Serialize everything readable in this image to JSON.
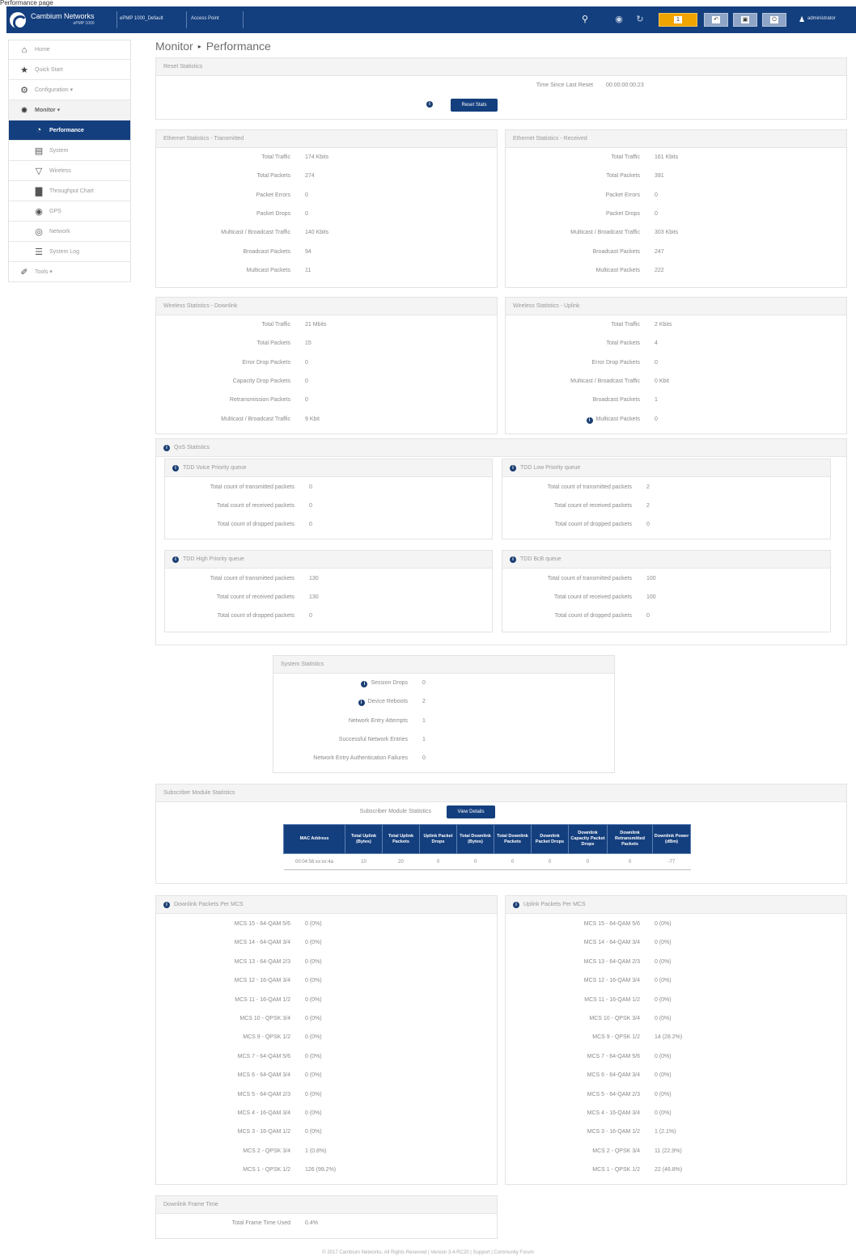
{
  "caption": "Performance page",
  "topbar": {
    "brand": "Cambium Networks",
    "brand_sub": "ePMP 1000",
    "device_name": "ePMP 1000_Default",
    "mode": "Access Point",
    "alert_count": "1",
    "user": "administrator"
  },
  "sidebar": {
    "items": [
      {
        "label": "Home",
        "icon": "home-icon",
        "level": "top",
        "state": ""
      },
      {
        "label": "Quick Start",
        "icon": "run-icon",
        "level": "top",
        "state": ""
      },
      {
        "label": "Configuration ▾",
        "icon": "gear-icon",
        "level": "top",
        "state": ""
      },
      {
        "label": "Monitor ▾",
        "icon": "monitor-icon",
        "level": "top",
        "state": "gray"
      },
      {
        "label": "Performance",
        "icon": "gauge-icon",
        "level": "sub",
        "state": "active"
      },
      {
        "label": "System",
        "icon": "system-icon",
        "level": "sub",
        "state": ""
      },
      {
        "label": "Wireless",
        "icon": "wifi-icon",
        "level": "sub",
        "state": ""
      },
      {
        "label": "Throughput Chart",
        "icon": "chart-icon",
        "level": "sub",
        "state": ""
      },
      {
        "label": "GPS",
        "icon": "globe-icon",
        "level": "sub",
        "state": ""
      },
      {
        "label": "Network",
        "icon": "network-icon",
        "level": "sub",
        "state": ""
      },
      {
        "label": "System Log",
        "icon": "log-icon",
        "level": "sub",
        "state": ""
      },
      {
        "label": "Tools ▾",
        "icon": "wrench-icon",
        "level": "top",
        "state": ""
      }
    ]
  },
  "breadcrumb": {
    "parent": "Monitor",
    "current": "Performance"
  },
  "reset": {
    "title": "Reset Statistics",
    "time_label": "Time Since Last Reset",
    "time_value": "00:00:00:00:23",
    "button": "Reset Stats"
  },
  "eth_tx": {
    "title": "Ethernet Statistics - Transmitted",
    "rows": [
      {
        "label": "Total Traffic",
        "value": "174 Kbits"
      },
      {
        "label": "Total Packets",
        "value": "274"
      },
      {
        "label": "Packet Errors",
        "value": "0"
      },
      {
        "label": "Packet Drops",
        "value": "0"
      },
      {
        "label": "Multicast / Broadcast Traffic",
        "value": "140 Kbits"
      },
      {
        "label": "Broadcast Packets",
        "value": "94"
      },
      {
        "label": "Multicast Packets",
        "value": "11"
      }
    ]
  },
  "eth_rx": {
    "title": "Ethernet Statistics - Received",
    "rows": [
      {
        "label": "Total Traffic",
        "value": "161 Kbits"
      },
      {
        "label": "Total Packets",
        "value": "391"
      },
      {
        "label": "Packet Errors",
        "value": "0"
      },
      {
        "label": "Packet Drops",
        "value": "0"
      },
      {
        "label": "Multicast / Broadcast Traffic",
        "value": "303 Kbits"
      },
      {
        "label": "Broadcast Packets",
        "value": "247"
      },
      {
        "label": "Multicast Packets",
        "value": "222"
      }
    ]
  },
  "wl_down": {
    "title": "Wireless Statistics - Downlink",
    "rows": [
      {
        "label": "Total Traffic",
        "value": "21 Mbits"
      },
      {
        "label": "Total Packets",
        "value": "15"
      },
      {
        "label": "Error Drop Packets",
        "value": "0"
      },
      {
        "label": "Capacity Drop Packets",
        "value": "0"
      },
      {
        "label": "Retransmission Packets",
        "value": "0"
      },
      {
        "label": "Multicast / Broadcast Traffic",
        "value": "9 Kbit"
      }
    ]
  },
  "wl_up": {
    "title": "Wireless Statistics - Uplink",
    "rows": [
      {
        "label": "Total Traffic",
        "value": "2 Kbits"
      },
      {
        "label": "Total Packets",
        "value": "4"
      },
      {
        "label": "Error Drop Packets",
        "value": "0"
      },
      {
        "label": "Multicast / Broadcast Traffic",
        "value": "0 Kbit"
      },
      {
        "label": "Broadcast Packets",
        "value": "1"
      },
      {
        "label": "Multicast Packets",
        "value": "0"
      }
    ]
  },
  "qos": {
    "title": "QoS Statistics",
    "queues": [
      {
        "title": "TDD Voice Priority queue",
        "rows": [
          {
            "label": "Total count of transmitted packets",
            "value": "0"
          },
          {
            "label": "Total count of received packets",
            "value": "0"
          },
          {
            "label": "Total count of dropped packets",
            "value": "0"
          }
        ]
      },
      {
        "title": "TDD Low Priority queue",
        "rows": [
          {
            "label": "Total count of transmitted packets",
            "value": "2"
          },
          {
            "label": "Total count of received packets",
            "value": "2"
          },
          {
            "label": "Total count of dropped packets",
            "value": "0"
          }
        ]
      },
      {
        "title": "TDD High Priority queue",
        "rows": [
          {
            "label": "Total count of transmitted packets",
            "value": "130"
          },
          {
            "label": "Total count of received packets",
            "value": "130"
          },
          {
            "label": "Total count of dropped packets",
            "value": "0"
          }
        ]
      },
      {
        "title": "TDD BcB queue",
        "rows": [
          {
            "label": "Total count of transmitted packets",
            "value": "100"
          },
          {
            "label": "Total count of received packets",
            "value": "100"
          },
          {
            "label": "Total count of dropped packets",
            "value": "0"
          }
        ]
      }
    ]
  },
  "system": {
    "title": "System Statistics",
    "rows": [
      {
        "label": "Session Drops",
        "value": "0",
        "info": true
      },
      {
        "label": "Device Reboots",
        "value": "2",
        "info": true
      },
      {
        "label": "Network Entry Attempts",
        "value": "1",
        "info": false
      },
      {
        "label": "Successful Network Entries",
        "value": "1",
        "info": false
      },
      {
        "label": "Network Entry Authentication Failures",
        "value": "0",
        "info": false
      }
    ]
  },
  "sm_stats": {
    "title": "Subscriber Module Statistics",
    "details_label": "Subscriber Module Statistics",
    "details_button": "View Details",
    "columns": [
      "MAC Address",
      "Total Uplink (Bytes)",
      "Total Uplink Packets",
      "Uplink Packet Drops",
      "Total Downlink (Bytes)",
      "Total Downlink Packets",
      "Downlink Packet Drops",
      "Downlink Capacity Packet Drops",
      "Downlink Retransmitted Packets",
      "Downlink Power (dBm)"
    ],
    "rows": [
      [
        "00:04:56:xx:xx:4a",
        "10",
        "20",
        "0",
        "0",
        "0",
        "0",
        "0",
        "0",
        "-77"
      ]
    ]
  },
  "down_mcs": {
    "title": "Downlink Packets Per MCS",
    "rows": [
      {
        "label": "MCS 15 - 64-QAM 5/6",
        "value": "0 (0%)"
      },
      {
        "label": "MCS 14 - 64-QAM 3/4",
        "value": "0 (0%)"
      },
      {
        "label": "MCS 13 - 64-QAM 2/3",
        "value": "0 (0%)"
      },
      {
        "label": "MCS 12 - 16-QAM 3/4",
        "value": "0 (0%)"
      },
      {
        "label": "MCS 11 - 16-QAM 1/2",
        "value": "0 (0%)"
      },
      {
        "label": "MCS 10 - QPSK 3/4",
        "value": "0 (0%)"
      },
      {
        "label": "MCS 9 - QPSK 1/2",
        "value": "0 (0%)"
      },
      {
        "label": "MCS 7 - 64-QAM 5/6",
        "value": "0 (0%)"
      },
      {
        "label": "MCS 6 - 64-QAM 3/4",
        "value": "0 (0%)"
      },
      {
        "label": "MCS 5 - 64-QAM 2/3",
        "value": "0 (0%)"
      },
      {
        "label": "MCS 4 - 16-QAM 3/4",
        "value": "0 (0%)"
      },
      {
        "label": "MCS 3 - 16-QAM 1/2",
        "value": "0 (0%)"
      },
      {
        "label": "MCS 2 - QPSK 3/4",
        "value": "1 (0.8%)"
      },
      {
        "label": "MCS 1 - QPSK 1/2",
        "value": "126 (99.2%)"
      }
    ]
  },
  "up_mcs": {
    "title": "Uplink Packets Per MCS",
    "rows": [
      {
        "label": "MCS 15 - 64-QAM 5/6",
        "value": "0 (0%)"
      },
      {
        "label": "MCS 14 - 64-QAM 3/4",
        "value": "0 (0%)"
      },
      {
        "label": "MCS 13 - 64-QAM 2/3",
        "value": "0 (0%)"
      },
      {
        "label": "MCS 12 - 16-QAM 3/4",
        "value": "0 (0%)"
      },
      {
        "label": "MCS 11 - 16-QAM 1/2",
        "value": "0 (0%)"
      },
      {
        "label": "MCS 10 - QPSK 3/4",
        "value": "0 (0%)"
      },
      {
        "label": "MCS 9 - QPSK 1/2",
        "value": "14 (28.2%)"
      },
      {
        "label": "MCS 7 - 64-QAM 5/6",
        "value": "0 (0%)"
      },
      {
        "label": "MCS 6 - 64-QAM 3/4",
        "value": "0 (0%)"
      },
      {
        "label": "MCS 5 - 64-QAM 2/3",
        "value": "0 (0%)"
      },
      {
        "label": "MCS 4 - 16-QAM 3/4",
        "value": "0 (0%)"
      },
      {
        "label": "MCS 3 - 16-QAM 1/2",
        "value": "1 (2.1%)"
      },
      {
        "label": "MCS 2 - QPSK 3/4",
        "value": "11 (22.9%)"
      },
      {
        "label": "MCS 1 - QPSK 1/2",
        "value": "22 (46.8%)"
      }
    ]
  },
  "frame": {
    "title": "Downlink Frame Time",
    "label": "Total Frame Time Used",
    "value": "0.4%"
  },
  "footer": "© 2017 Cambium Networks, All Rights Reserved | Version 3.4-RC20 | Support | Community Forum"
}
